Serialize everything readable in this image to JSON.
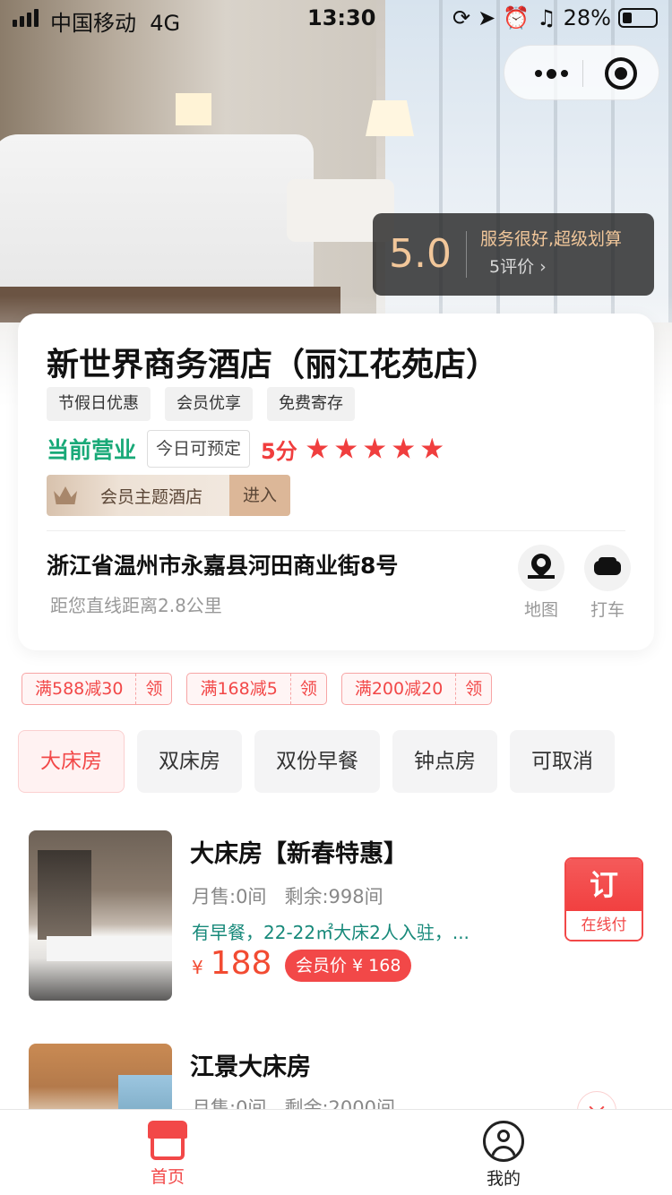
{
  "status_bar": {
    "carrier": "中国移动",
    "network": "4G",
    "time": "13:30",
    "battery": "28%"
  },
  "hero": {
    "rating_score": "5.0",
    "rating_text": "服务很好,超级划算",
    "review_count": "5评价",
    "review_chevron": "›"
  },
  "hotel": {
    "name": "新世界商务酒店（丽江花苑店）",
    "tags": [
      "节假日优惠",
      "会员优享",
      "免费寄存"
    ],
    "open_status": "当前营业",
    "booking_status": "今日可预定",
    "score": "5分",
    "stars": 5,
    "member_theme": "会员主题酒店",
    "member_enter": "进入",
    "address": "浙江省温州市永嘉县河田商业街8号",
    "distance": "距您直线距离2.8公里",
    "map_label": "地图",
    "taxi_label": "打车"
  },
  "coupons": [
    {
      "amount": "满588减30",
      "action": "领"
    },
    {
      "amount": "满168减5",
      "action": "领"
    },
    {
      "amount": "满200减20",
      "action": "领"
    }
  ],
  "filters": [
    "大床房",
    "双床房",
    "双份早餐",
    "钟点房",
    "可取消"
  ],
  "active_filter": "大床房",
  "rooms": [
    {
      "name": "大床房【新春特惠】",
      "sales": "月售:0间",
      "remaining": "剩余:998间",
      "features": "有早餐，22-22㎡大床2人入驻，...",
      "currency": "¥",
      "price": "188",
      "member_price": "会员价 ¥ 168",
      "order_label": "订",
      "order_sub": "在线付"
    },
    {
      "name": "江景大床房",
      "sales": "月售:0间",
      "remaining": "剩余:2000间"
    }
  ],
  "tabbar": {
    "home": "首页",
    "me": "我的"
  },
  "colors": {
    "accent": "#f24848",
    "open_green": "#19a978",
    "feature_teal": "#17897a",
    "rating_gold": "#f2c79a"
  }
}
